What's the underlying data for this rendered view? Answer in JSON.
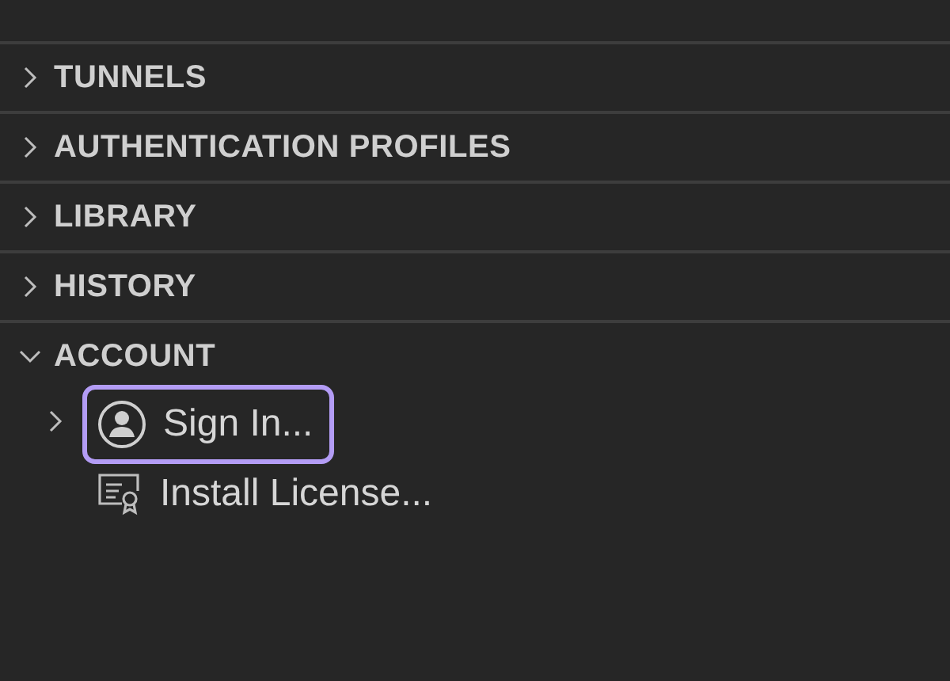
{
  "sections": [
    {
      "title": "TUNNELS",
      "expanded": false
    },
    {
      "title": "AUTHENTICATION PROFILES",
      "expanded": false
    },
    {
      "title": "LIBRARY",
      "expanded": false
    },
    {
      "title": "HISTORY",
      "expanded": false
    },
    {
      "title": "ACCOUNT",
      "expanded": true,
      "items": [
        {
          "label": "Sign In...",
          "kind": "user",
          "expandable": true,
          "focused": true
        },
        {
          "label": "Install License...",
          "kind": "license",
          "expandable": false,
          "focused": false
        }
      ]
    }
  ]
}
